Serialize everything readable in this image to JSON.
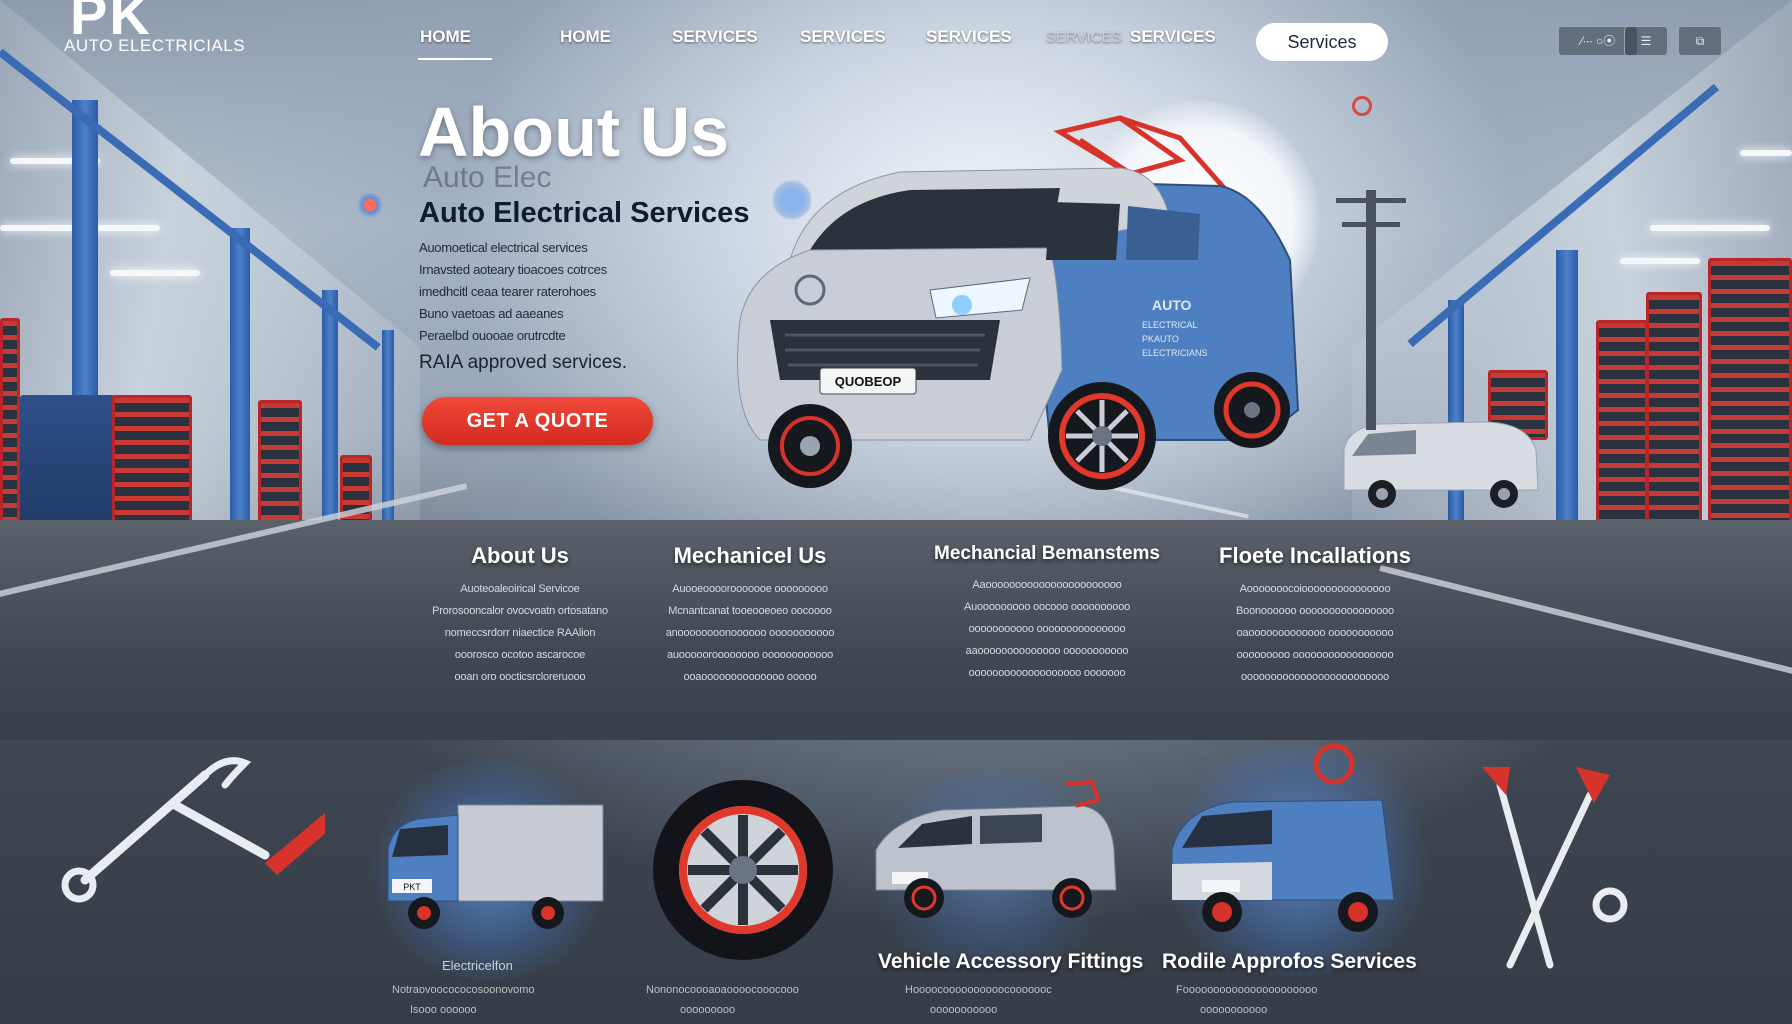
{
  "brand": {
    "logo_text": "PK",
    "subtitle": "AUTO ELECTRICIALS"
  },
  "nav": {
    "items": [
      "HOME",
      "HOME",
      "SERVICES",
      "SERVICES",
      "SERVICES",
      "SERVICES",
      "SERVICES"
    ],
    "pill": "Services",
    "tools": [
      "⁄∙∙∙ ○⦿",
      "☰",
      "⧉"
    ]
  },
  "hero": {
    "title": "About Us",
    "ghost_heading": "Auto Elec",
    "subtitle": "Auto Electrical Services",
    "lines": [
      "Auomoetical electrical services",
      "Irnavsted aoteary tioacoes cotrces",
      "imedhcitl ceaa tearer raterohoes",
      "Buno vaetoas ad aaeanes",
      "Peraelbd ouooae orutrcdte"
    ],
    "last_line": "RAIA approved services.",
    "cta": "GET A QUOTE"
  },
  "van": {
    "plate": "QUOBEOP",
    "side_text": [
      "AUTO",
      "ELECTRICAL",
      "PKAUTO",
      "ELECTRICIANS"
    ]
  },
  "services": [
    {
      "title": "About Us",
      "lines": [
        "Auoteoaleoirical Servicoe",
        "Prorosooncalor ovocvoatn ortosatano",
        "nomeccsrdorr niaectice RAAlion",
        "ooorosco ocotoo ascarocoe",
        "ooan oro oocticsrcloreruooo"
      ]
    },
    {
      "title": "Mechanicel Us",
      "lines": [
        "Auooeoooorooooooe ooooooooo",
        "Mcnantcanat tooeooeoeo oocoooo",
        "anoooooooonoooooo ooooooooooo",
        "auoooooroooooooo oooooooooooo",
        "ooaoooooooooooooo ooooo"
      ]
    },
    {
      "title": "Mechancial Bemanstems",
      "lines": [
        "Aaooooooooooooooooooooooo",
        "Auooooooooo oocooo oooooooooo",
        "ooooooooooo ooooooooooooooo",
        "aaoooooooooooooo ooooooooooo",
        "ooooooooooooooooooo ooooooo"
      ]
    },
    {
      "title": "Floete Incallations",
      "lines": [
        "Aooooooocoiooooooooooooooo",
        "Boonoooooo oooooooooooooooo",
        "oaooooooooooooo ooooooooooo",
        "ooooooooo ooooooooooooooooo",
        "ooooooooooooooooooooooooo"
      ]
    }
  ],
  "bottom": {
    "truck_caption": "Electricelfon",
    "truck_plate": "PKT",
    "captions": [
      "Vehicle Accessory Fittings",
      "Rodile Approfos Services"
    ],
    "footer_lines": [
      "Notraovoocococosoonovomo",
      "Nononocoooaoaoooocooocooo",
      "Hoooocoooooooooocooooooc",
      "Foooooooooooooooooooooo"
    ],
    "footer_lines2": [
      "Isooo oooooo",
      "ooooooooo",
      "ooooooooooo",
      "ooooooooooo"
    ]
  },
  "colors": {
    "accent_red": "#e03a2c",
    "accent_blue": "#3b6fb8",
    "van_blue": "#4e7fc0",
    "van_silver": "#c9ced6"
  }
}
